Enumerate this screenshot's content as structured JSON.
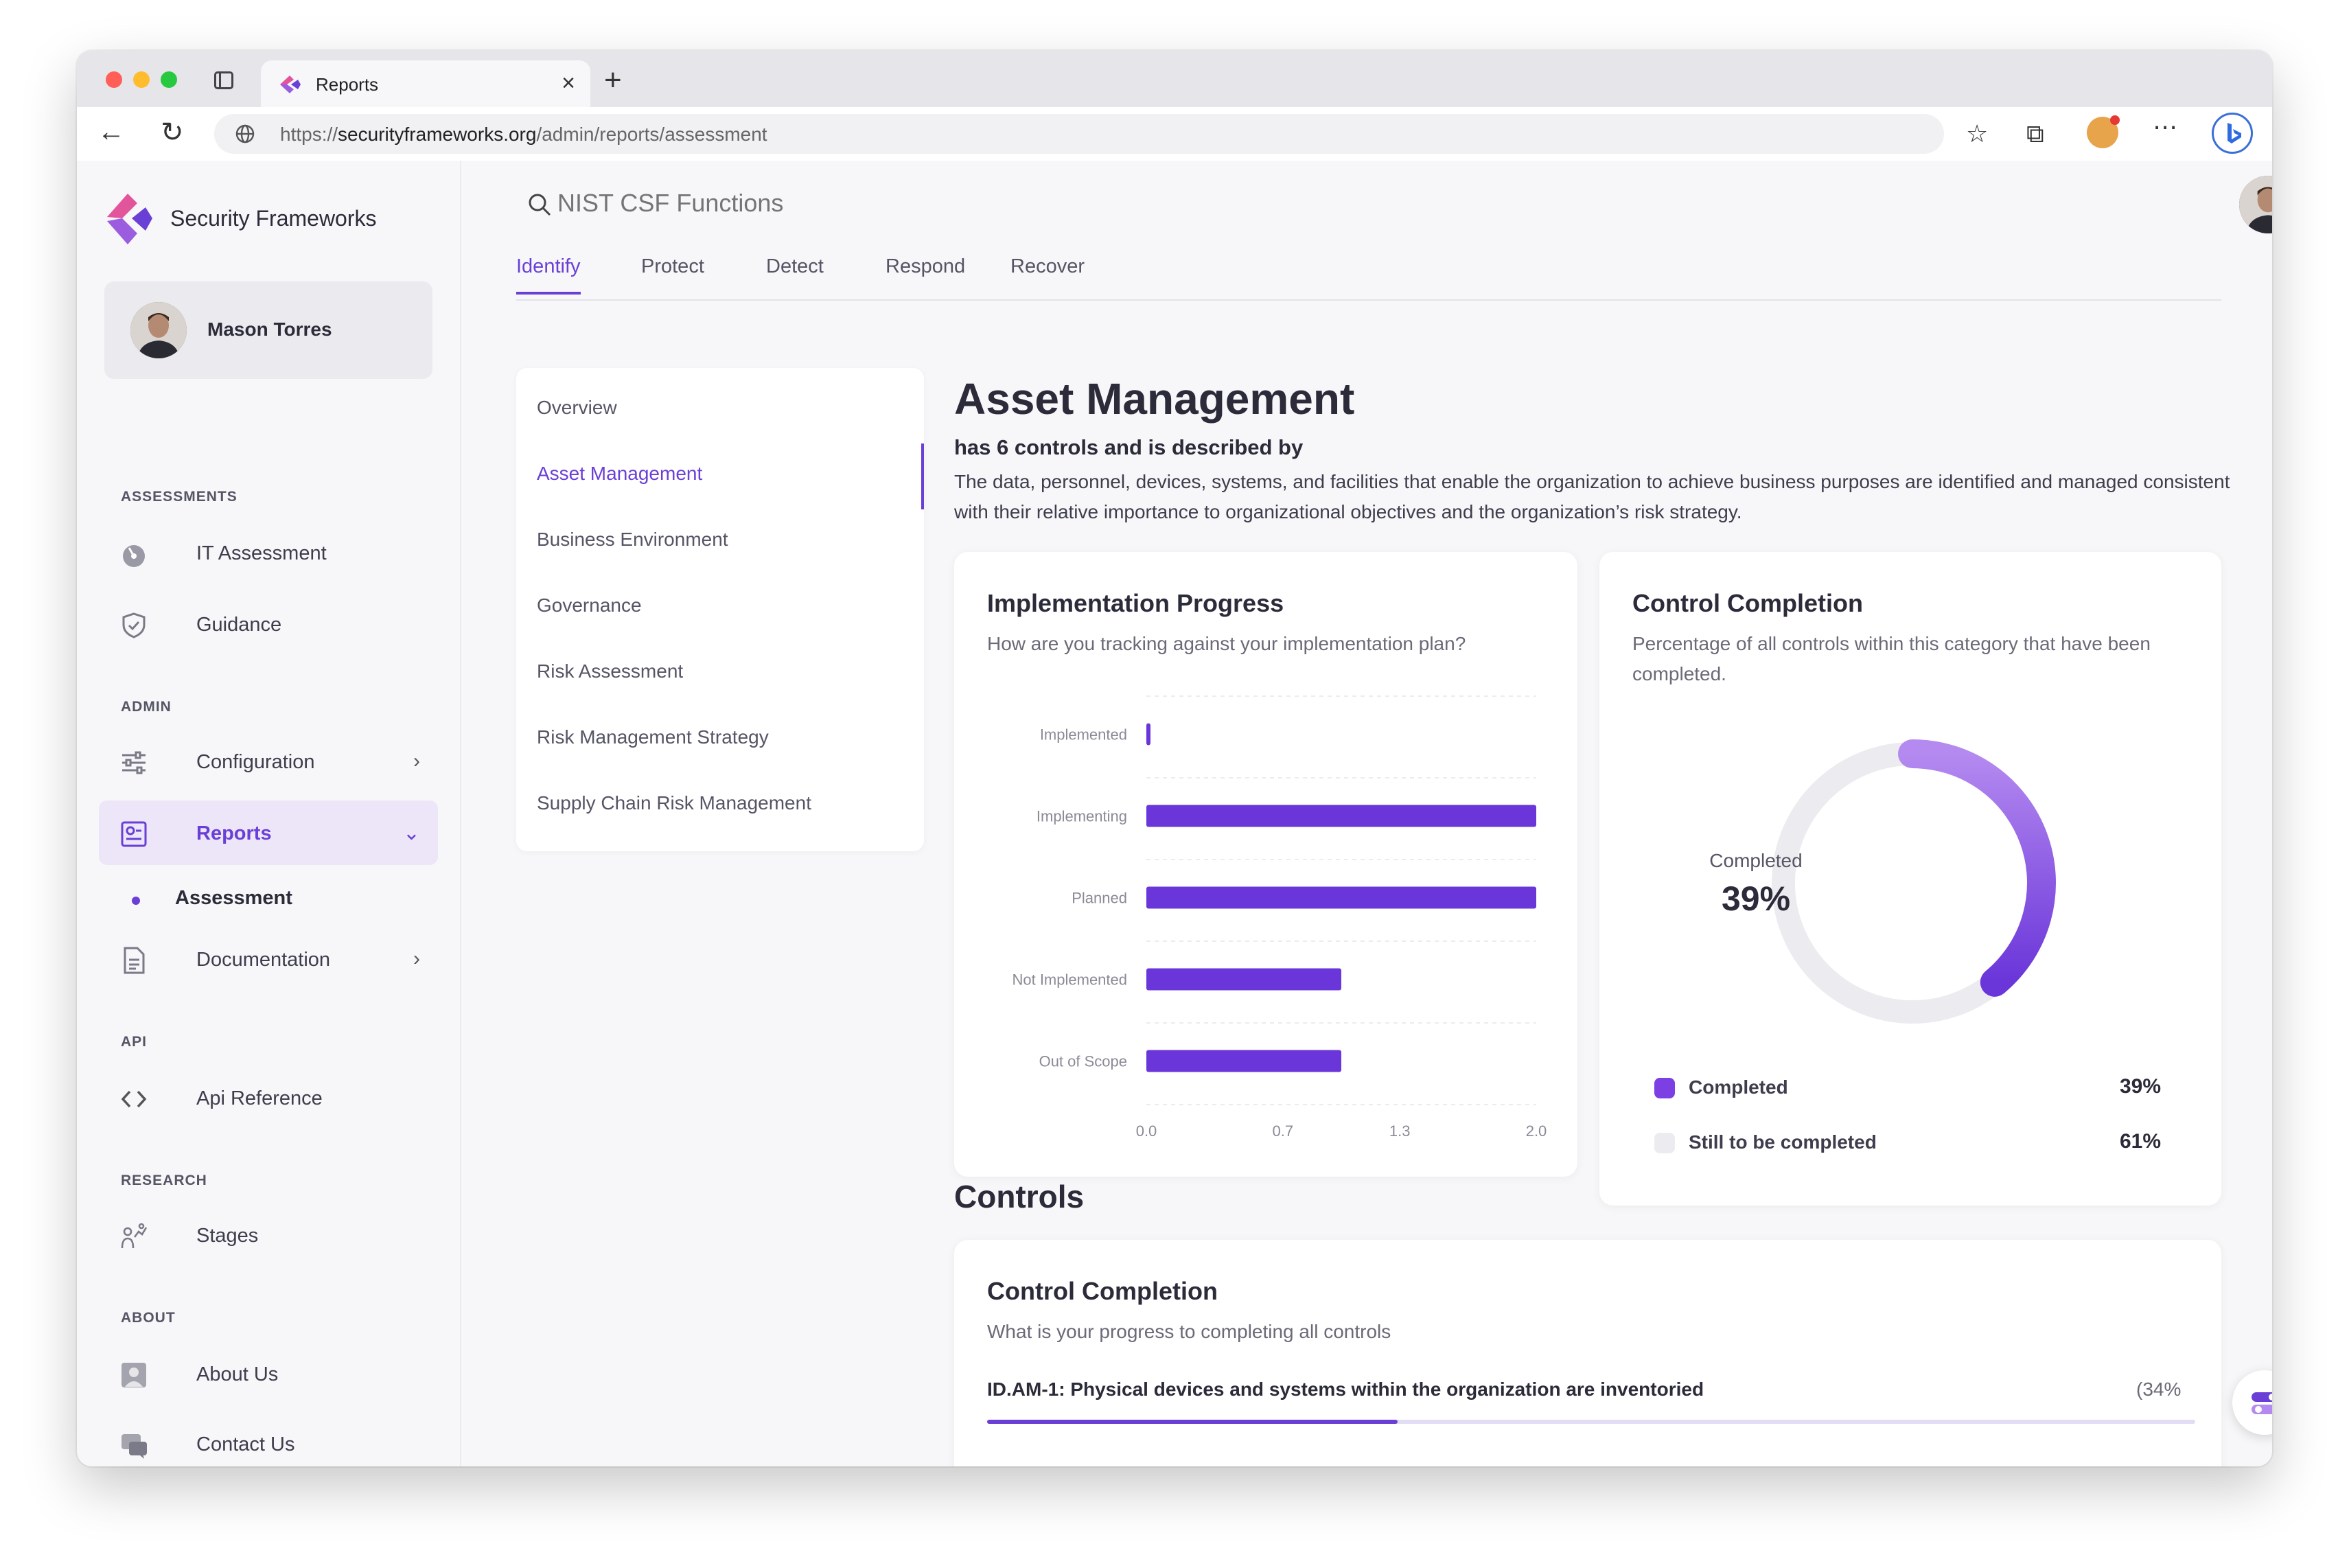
{
  "browser": {
    "tab_title": "Reports",
    "url_prefix": "https://",
    "url_host": "securityframeworks.org",
    "url_path": "/admin/reports/assessment"
  },
  "app": {
    "brand": "Security Frameworks",
    "user_name": "Mason Torres",
    "search_placeholder": "NIST CSF Functions"
  },
  "sidebar": {
    "sections": [
      {
        "label": "ASSESSMENTS",
        "items": [
          {
            "label": "IT Assessment",
            "icon": "gauge-icon"
          },
          {
            "label": "Guidance",
            "icon": "shield-check-icon"
          }
        ]
      },
      {
        "label": "ADMIN",
        "items": [
          {
            "label": "Configuration",
            "icon": "sliders-icon"
          },
          {
            "label": "Reports",
            "icon": "report-icon"
          },
          {
            "label": "Assessment"
          },
          {
            "label": "Documentation",
            "icon": "document-icon"
          }
        ]
      },
      {
        "label": "API",
        "items": [
          {
            "label": "Api Reference",
            "icon": "code-icon"
          }
        ]
      },
      {
        "label": "RESEARCH",
        "items": [
          {
            "label": "Stages",
            "icon": "chart-person-icon"
          }
        ]
      },
      {
        "label": "ABOUT",
        "items": [
          {
            "label": "About Us",
            "icon": "person-card-icon"
          },
          {
            "label": "Contact Us",
            "icon": "chat-icon"
          }
        ]
      }
    ]
  },
  "tabs": [
    "Identify",
    "Protect",
    "Detect",
    "Respond",
    "Recover"
  ],
  "subnav": [
    "Overview",
    "Asset Management",
    "Business Environment",
    "Governance",
    "Risk Assessment",
    "Risk Management Strategy",
    "Supply Chain Risk Management"
  ],
  "section": {
    "title": "Asset Management",
    "subtitle": "has 6 controls and is described by",
    "description": "The data, personnel, devices, systems, and facilities that enable the organization to achieve business purposes are identified and managed consistent with their relative importance to organizational objectives and the organization’s risk strategy."
  },
  "impl_card": {
    "title": "Implementation Progress",
    "subtitle": "How are you tracking against your implementation plan?"
  },
  "completion_card": {
    "title": "Control Completion",
    "subtitle": "Percentage of all controls within this category that have been completed.",
    "center_label": "Completed",
    "center_value": "39%",
    "legend": [
      {
        "label": "Completed",
        "value": "39%",
        "color": "#7b3fe4"
      },
      {
        "label": "Still to be completed",
        "value": "61%",
        "color": "#ececf0"
      }
    ]
  },
  "controls": {
    "heading": "Controls",
    "card_title": "Control Completion",
    "card_subtitle": "What is your progress to completing all controls",
    "rows": [
      {
        "label": "ID.AM-1: Physical devices and systems within the organization are inventoried",
        "pct_text": "(34%",
        "fraction": 0.34
      }
    ]
  },
  "colors": {
    "accent": "#6a3fd6",
    "bar": "#6a35d9"
  },
  "chart_data": [
    {
      "type": "bar",
      "orientation": "horizontal",
      "title": "Implementation Progress",
      "categories": [
        "Implemented",
        "Implementing",
        "Planned",
        "Not Implemented",
        "Out of Scope"
      ],
      "values": [
        0.02,
        2.0,
        2.0,
        1.0,
        1.0
      ],
      "x_ticks": [
        "0.0",
        "0.7",
        "1.3",
        "2.0"
      ],
      "xlim": [
        0,
        2
      ],
      "grid": true
    },
    {
      "type": "pie",
      "variant": "donut",
      "title": "Control Completion",
      "categories": [
        "Completed",
        "Still to be completed"
      ],
      "values": [
        39,
        61
      ]
    }
  ]
}
